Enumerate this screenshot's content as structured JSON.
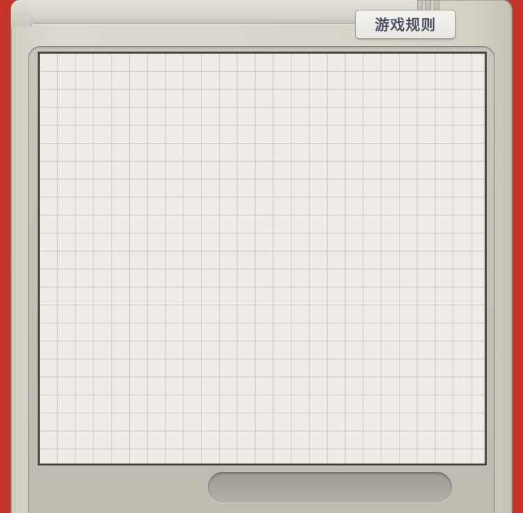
{
  "header": {
    "rules_button_label": "游戏规则"
  },
  "colors": {
    "background": "#c9372b",
    "device_body": "#d9d7cd",
    "screen": "#f0ebe7",
    "screen_border": "#4a4639",
    "button_text": "#4d5468"
  }
}
